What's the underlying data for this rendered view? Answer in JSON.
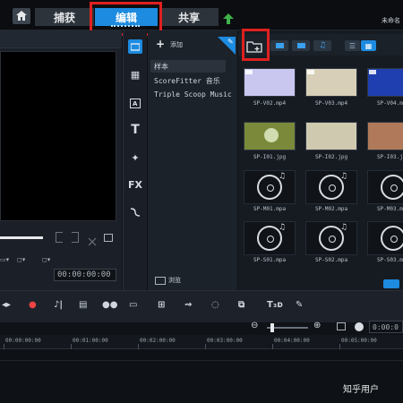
{
  "topbar": {
    "tabs": [
      {
        "label": "捕获"
      },
      {
        "label": "编辑"
      },
      {
        "label": "共享"
      }
    ],
    "right_text": "未命名"
  },
  "preview": {
    "timecode": "00:00:00:00"
  },
  "library": {
    "add_label": "添加",
    "items": [
      {
        "label": "样本"
      },
      {
        "label": "ScoreFitter 音乐"
      },
      {
        "label": "Triple Scoop Music"
      }
    ],
    "browse_label": "浏览"
  },
  "media": {
    "items": [
      {
        "label": "SP-V02.mp4",
        "kind": "video",
        "color": "#c9c7f0"
      },
      {
        "label": "SP-V03.mp4",
        "kind": "video",
        "color": "#d7cfb8"
      },
      {
        "label": "SP-V04.mp4",
        "kind": "video",
        "color": "#1f3fb0"
      },
      {
        "label": "SP-I01.jpg",
        "kind": "photo",
        "color": "#7a8a3a"
      },
      {
        "label": "SP-I02.jpg",
        "kind": "photo",
        "color": "#cfc9b0"
      },
      {
        "label": "SP-I03.jpg",
        "kind": "photo",
        "color": "#b07a5a"
      },
      {
        "label": "SP-M01.mpa",
        "kind": "audio"
      },
      {
        "label": "SP-M02.mpa",
        "kind": "audio"
      },
      {
        "label": "SP-M03.mpa",
        "kind": "audio"
      },
      {
        "label": "SP-S01.mpa",
        "kind": "audio"
      },
      {
        "label": "SP-S02.mpa",
        "kind": "audio"
      },
      {
        "label": "SP-S03.mpa",
        "kind": "audio"
      }
    ]
  },
  "timeline": {
    "timecode": "0:00:0",
    "ruler": [
      "00:00:00:00",
      "00:01:00:00",
      "00:02:00:00",
      "00:03:00:00",
      "00:04:00:00",
      "00:05:00:00"
    ]
  },
  "watermark": "知乎用户",
  "colors": {
    "accent": "#1d8be0",
    "highlight": "#e02020"
  }
}
